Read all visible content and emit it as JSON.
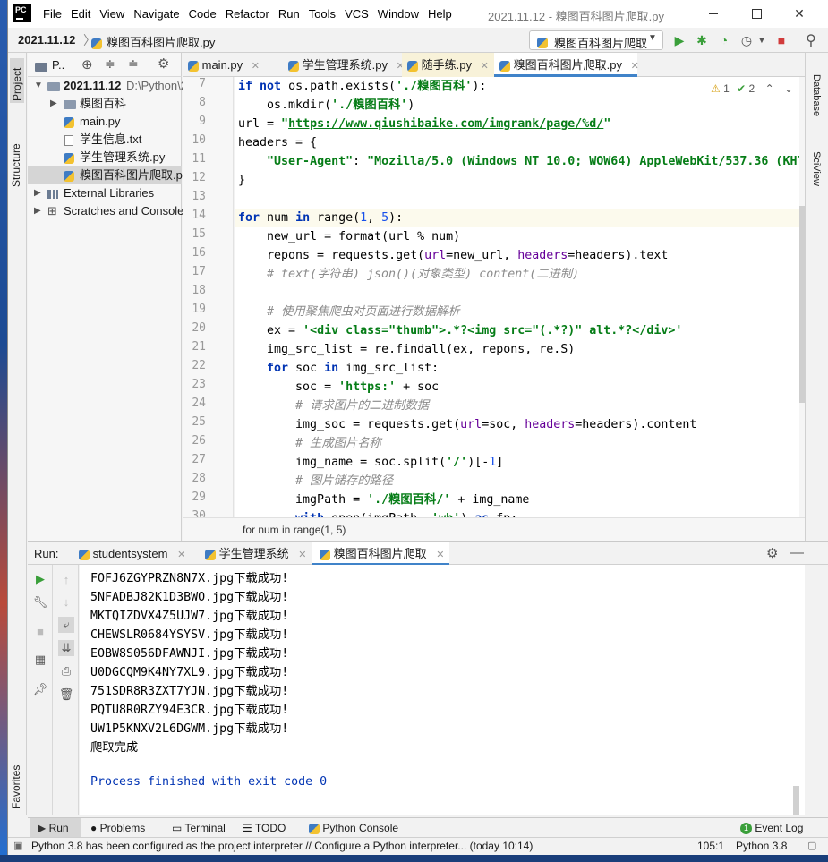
{
  "window": {
    "title": "2021.11.12 - 糗图百科图片爬取.py",
    "menu": [
      "File",
      "Edit",
      "View",
      "Navigate",
      "Code",
      "Refactor",
      "Run",
      "Tools",
      "VCS",
      "Window",
      "Help"
    ],
    "logo_text": "PC"
  },
  "nav": {
    "project": "2021.11.12",
    "file": "糗图百科图片爬取.py",
    "run_config": "糗图百科图片爬取"
  },
  "left_strip": {
    "project": "Project",
    "structure": "Structure",
    "favorites": "Favorites"
  },
  "right_strip": {
    "database": "Database",
    "sciview": "SciView"
  },
  "project_panel": {
    "header_label": "P..",
    "root_name": "2021.11.12",
    "root_path": "D:\\Python\\2",
    "items": [
      {
        "label": "糗图百科"
      },
      {
        "label": "main.py"
      },
      {
        "label": "学生信息.txt"
      },
      {
        "label": "学生管理系统.py"
      },
      {
        "label": "糗图百科图片爬取.py"
      }
    ],
    "external": "External Libraries",
    "scratches": "Scratches and Consoles"
  },
  "editor_tabs": [
    "main.py",
    "学生管理系统.py",
    "随手练.py",
    "糗图百科图片爬取.py"
  ],
  "inspection": {
    "warnings": "1",
    "weak": "2"
  },
  "code": {
    "line_numbers": [
      "7",
      "8",
      "9",
      "10",
      "11",
      "12",
      "13",
      "14",
      "15",
      "16",
      "17",
      "18",
      "19",
      "20",
      "21",
      "22",
      "23",
      "24",
      "25",
      "26",
      "27",
      "28",
      "29",
      "30"
    ],
    "lines": [
      "if not os.path.exists('./糗图百科'):",
      "    os.mkdir('./糗图百科')",
      "url = \"https://www.qiushibaike.com/imgrank/page/%d/\"",
      "headers = {",
      "    \"User-Agent\": \"Mozilla/5.0 (Windows NT 10.0; WOW64) AppleWebKit/537.36 (KHT",
      "}",
      "",
      "for num in range(1, 5):",
      "    new_url = format(url % num)",
      "    repons = requests.get(url=new_url, headers=headers).text",
      "    # text(字符串) json()(对象类型) content(二进制)",
      "",
      "    # 使用聚焦爬虫对页面进行数据解析",
      "    ex = '<div class=\"thumb\">.*?<img src=\"(.*?)\" alt.*?</div>'",
      "    img_src_list = re.findall(ex, repons, re.S)",
      "    for soc in img_src_list:",
      "        soc = 'https:' + soc",
      "        # 请求图片的二进制数据",
      "        img_soc = requests.get(url=soc, headers=headers).content",
      "        # 生成图片名称",
      "        img_name = soc.split('/')[-1]",
      "        # 图片储存的路径",
      "        imgPath = './糗图百科/' + img_name",
      "        with open(imgPath, 'wb') as fp:"
    ],
    "breadcrumb": "for num in range(1, 5)"
  },
  "run": {
    "label": "Run:",
    "tabs": [
      "studentsystem",
      "学生管理系统",
      "糗图百科图片爬取"
    ],
    "output": [
      "FOFJ6ZGYPRZN8N7X.jpg下载成功!",
      "5NFADBJ82K1D3BWO.jpg下载成功!",
      "MKTQIZDVX4Z5UJW7.jpg下载成功!",
      "CHEWSLR0684YSYSV.jpg下载成功!",
      "EOBW8S056DFAWNJI.jpg下载成功!",
      "U0DGCQM9K4NY7XL9.jpg下载成功!",
      "751SDR8R3ZXT7YJN.jpg下载成功!",
      "PQTU8R0RZY94E3CR.jpg下载成功!",
      "UW1P5KNXV2L6DGWM.jpg下载成功!",
      "爬取完成",
      "",
      "Process finished with exit code 0"
    ]
  },
  "bottom_tabs": [
    "Run",
    "Problems",
    "Terminal",
    "TODO",
    "Python Console",
    "Event Log"
  ],
  "event_log_count": "1",
  "status": {
    "message": "Python 3.8 has been configured as the project interpreter // Configure a Python interpreter... (today 10:14)",
    "position": "105:1",
    "interpreter": "Python 3.8"
  }
}
